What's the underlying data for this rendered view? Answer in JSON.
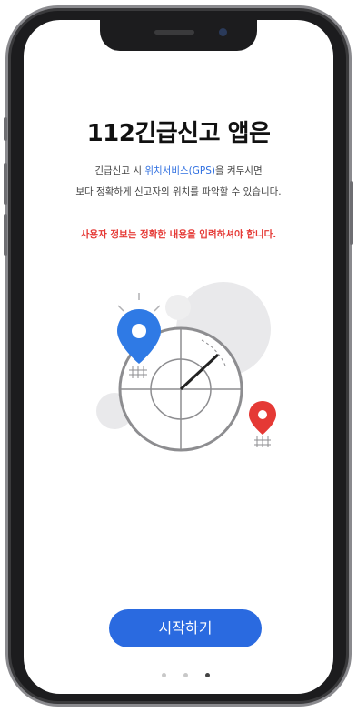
{
  "intro": {
    "title": "112긴급신고 앱은",
    "desc_line1_prefix": "긴급신고 시 ",
    "desc_line1_highlight": "위치서비스(GPS)",
    "desc_line1_suffix": "을 켜두시면",
    "desc_line2": "보다 정확하게 신고자의 위치를 파악할 수 있습니다.",
    "warning": "사용자 정보는 정확한 내용을 입력하셔야 합니다."
  },
  "buttons": {
    "start_label": "시작하기"
  },
  "pagination": {
    "total": 3,
    "active_index": 2
  },
  "colors": {
    "accent": "#2a6ae0",
    "warning": "#e53935",
    "pin_blue": "#2f7ae5",
    "pin_red": "#e53935"
  },
  "icons": {
    "blue_pin": "location-pin-icon",
    "red_pin": "location-pin-icon",
    "radar": "radar-icon"
  }
}
